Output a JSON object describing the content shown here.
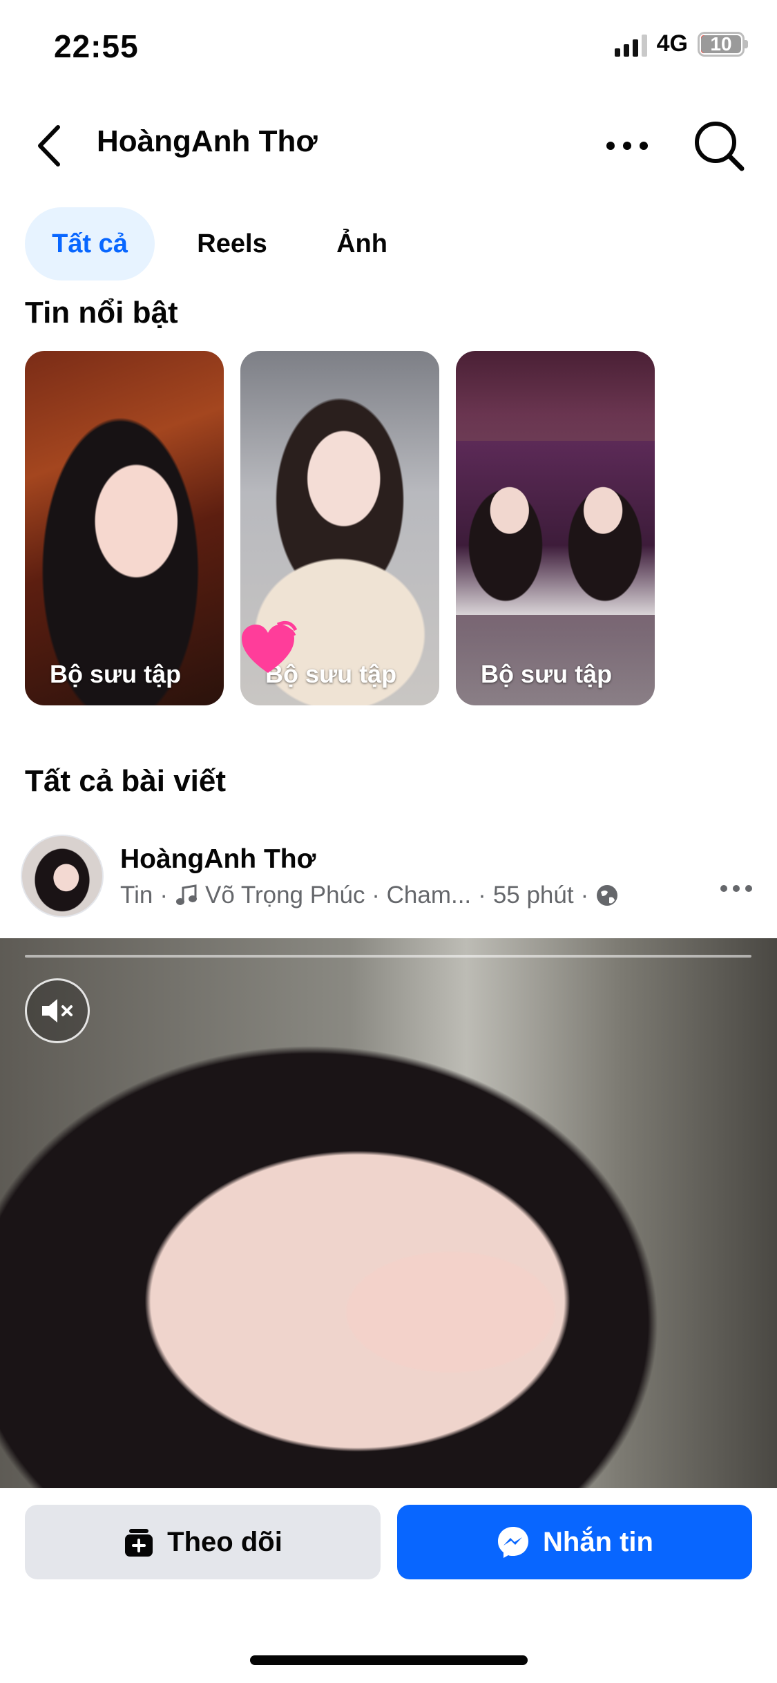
{
  "status_bar": {
    "time": "22:55",
    "network": "4G",
    "battery": "10"
  },
  "header": {
    "title": "HoàngAnh Thơ"
  },
  "tabs": [
    {
      "label": "Tất cả",
      "active": true
    },
    {
      "label": "Reels",
      "active": false
    },
    {
      "label": "Ảnh",
      "active": false
    }
  ],
  "highlights": {
    "title": "Tin nổi bật",
    "items": [
      {
        "label": "Bộ sưu tập"
      },
      {
        "label": "Bộ sưu tập"
      },
      {
        "label": "Bộ sưu tập"
      }
    ]
  },
  "posts_section": {
    "title": "Tất cả bài viết"
  },
  "post": {
    "author": "HoàngAnh Thơ",
    "type": "Tin",
    "music": "Võ Trọng Phúc · Cham...",
    "time": "55 phút",
    "privacy_icon": "globe-icon"
  },
  "actions": {
    "follow": "Theo dõi",
    "message": "Nhắn tin"
  },
  "colors": {
    "accent": "#0866ff",
    "active_tab_bg": "#e7f3ff",
    "secondary_button": "#e4e6eb"
  }
}
